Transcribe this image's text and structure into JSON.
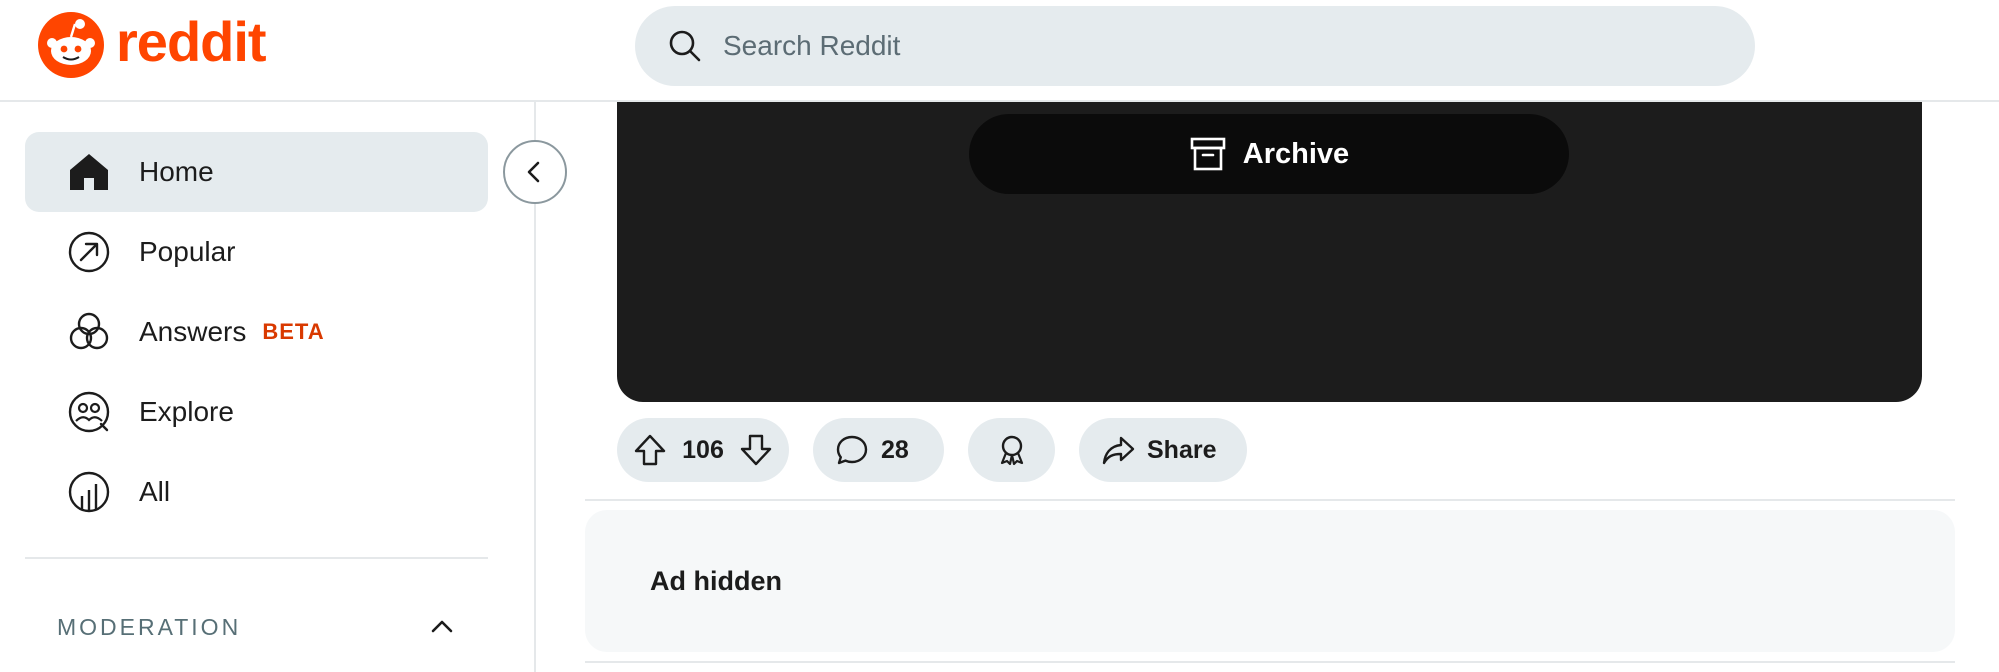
{
  "header": {
    "logo_text": "reddit",
    "search": {
      "placeholder": "Search Reddit"
    }
  },
  "sidebar": {
    "items": [
      {
        "label": "Home",
        "icon": "home-icon",
        "active": true
      },
      {
        "label": "Popular",
        "icon": "popular-icon"
      },
      {
        "label": "Answers",
        "icon": "answers-icon",
        "badge": "BETA"
      },
      {
        "label": "Explore",
        "icon": "explore-icon"
      },
      {
        "label": "All",
        "icon": "all-icon"
      }
    ],
    "section": {
      "title": "MODERATION",
      "icon": "chevron-up-icon"
    }
  },
  "post": {
    "archive_label": "Archive",
    "upvotes": "106",
    "comments": "28",
    "share_label": "Share"
  },
  "ad": {
    "text": "Ad hidden"
  },
  "colors": {
    "brand": "#ff4500",
    "pill_bg": "#e5ebee",
    "beta": "#d93900",
    "media_bg": "#1c1c1c"
  }
}
